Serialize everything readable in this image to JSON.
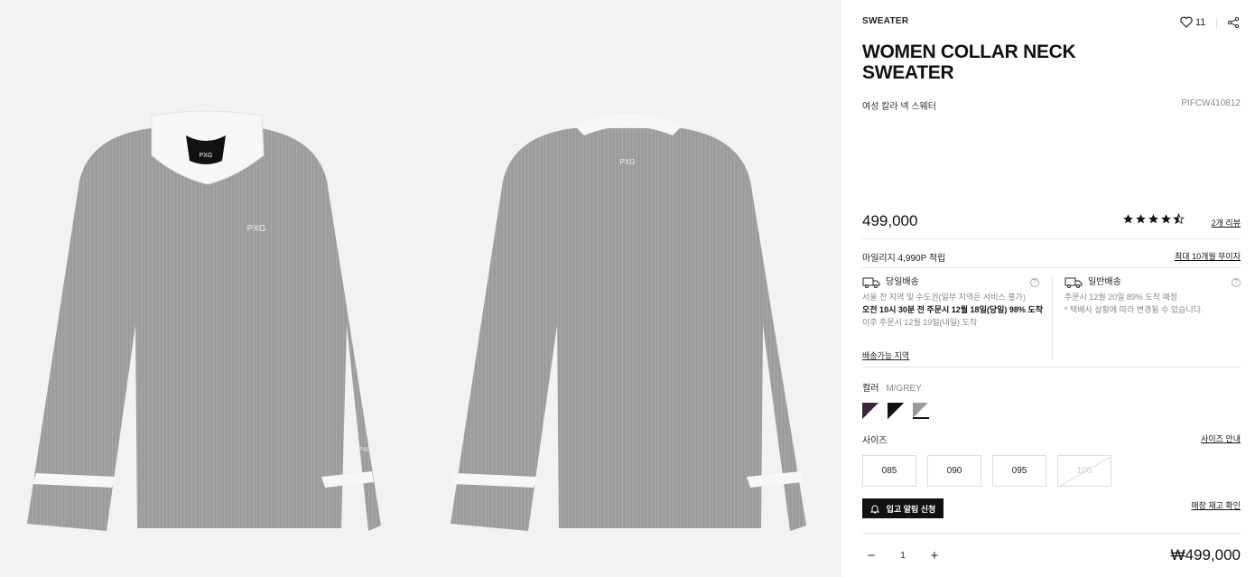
{
  "product": {
    "category": "SWEATER",
    "title": "WOMEN COLLAR NECK SWEATER",
    "subtitle_ko": "여성 칼라 넥 스웨터",
    "code": "PIFCW410812",
    "price": "499,000",
    "rating": 4.5,
    "review_link": "2개 리뷰",
    "wish_count": "11"
  },
  "mileage": {
    "text": "마일리지 4,990P 적립",
    "installment_link": "최대 10개월 무이자"
  },
  "shipping": {
    "same_day": {
      "title": "당일배송",
      "line1": "서울 전 지역 및 수도권(일부 지역은 서비스 불가)",
      "line2": "오전 10시 30분 전 주문시 12월 18일(당일) 98% 도착",
      "line3": "이후 주문시 12월 19일(내일) 도착",
      "area_link": "배송가능 지역"
    },
    "standard": {
      "title": "일반배송",
      "line1": "주문시 12월 20일 89% 도착 예정",
      "line2": "* 택배사 상황에 따라 변경될 수 있습니다."
    }
  },
  "color": {
    "label": "컬러",
    "selected": "M/GREY",
    "swatches": [
      "#3d2342",
      "#111111",
      "#9a9a9a"
    ]
  },
  "size": {
    "label": "사이즈",
    "guide_link": "사이즈 안내",
    "options": [
      "085",
      "090",
      "095",
      "100"
    ]
  },
  "restock": {
    "button": "입고 알림 신청",
    "store_link": "매장 재고 확인"
  },
  "order": {
    "quantity": "1",
    "total": "₩499,000"
  },
  "colors": {
    "sweater": "#9c9c9c",
    "collar": "#f7f7f7",
    "background": "#f2f2f2"
  }
}
